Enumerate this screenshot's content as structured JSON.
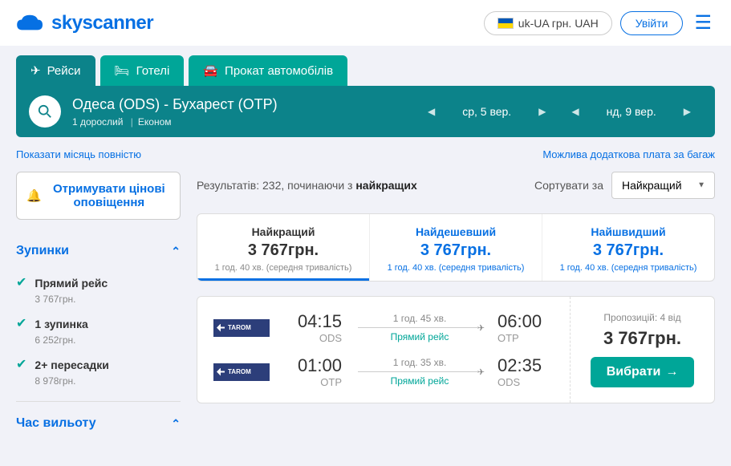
{
  "header": {
    "logo_text": "skyscanner",
    "locale": "uk-UA грн. UAH",
    "login": "Увійти"
  },
  "tabs": {
    "flights": "Рейси",
    "hotels": "Готелі",
    "cars": "Прокат автомобілів"
  },
  "search": {
    "route": "Одеса (ODS) - Бухарест (OTP)",
    "pax": "1 дорослий",
    "cabin": "Економ",
    "date_out": "ср, 5 вер.",
    "date_return": "нд, 9 вер."
  },
  "links": {
    "show_month": "Показати місяць повністю",
    "baggage_fee": "Можлива додаткова плата за багаж"
  },
  "sidebar": {
    "alert_button": "Отримувати цінові оповіщення",
    "stops": {
      "title": "Зупинки",
      "items": [
        {
          "label": "Прямий рейс",
          "price": "3 767грн."
        },
        {
          "label": "1 зупинка",
          "price": "6 252грн."
        },
        {
          "label": "2+ пересадки",
          "price": "8 978грн."
        }
      ]
    },
    "departure_time": {
      "title": "Час вильоту"
    }
  },
  "results": {
    "count_prefix": "Результатів: ",
    "count": "232",
    "count_suffix": ", починаючи з ",
    "count_sort": "найкращих",
    "sort_label": "Сортувати за",
    "sort_value": "Найкращий"
  },
  "summary": {
    "best": {
      "title": "Найкращий",
      "price": "3 767грн.",
      "duration": "1 год. 40 хв. (середня тривалість)"
    },
    "cheapest": {
      "title": "Найдешевший",
      "price": "3 767грн.",
      "duration": "1 год. 40 хв. (середня тривалість)"
    },
    "fastest": {
      "title": "Найшвидший",
      "price": "3 767грн.",
      "duration": "1 год. 40 хв. (середня тривалість)"
    }
  },
  "flight": {
    "airline": "TAROM",
    "legs": [
      {
        "dep_time": "04:15",
        "dep_airport": "ODS",
        "duration": "1 год. 45 хв.",
        "direct": "Прямий рейс",
        "arr_time": "06:00",
        "arr_airport": "OTP"
      },
      {
        "dep_time": "01:00",
        "dep_airport": "OTP",
        "duration": "1 год. 35 хв.",
        "direct": "Прямий рейс",
        "arr_time": "02:35",
        "arr_airport": "ODS"
      }
    ],
    "offers": "Пропозицій: 4 від",
    "price": "3 767грн.",
    "select": "Вибрати"
  }
}
